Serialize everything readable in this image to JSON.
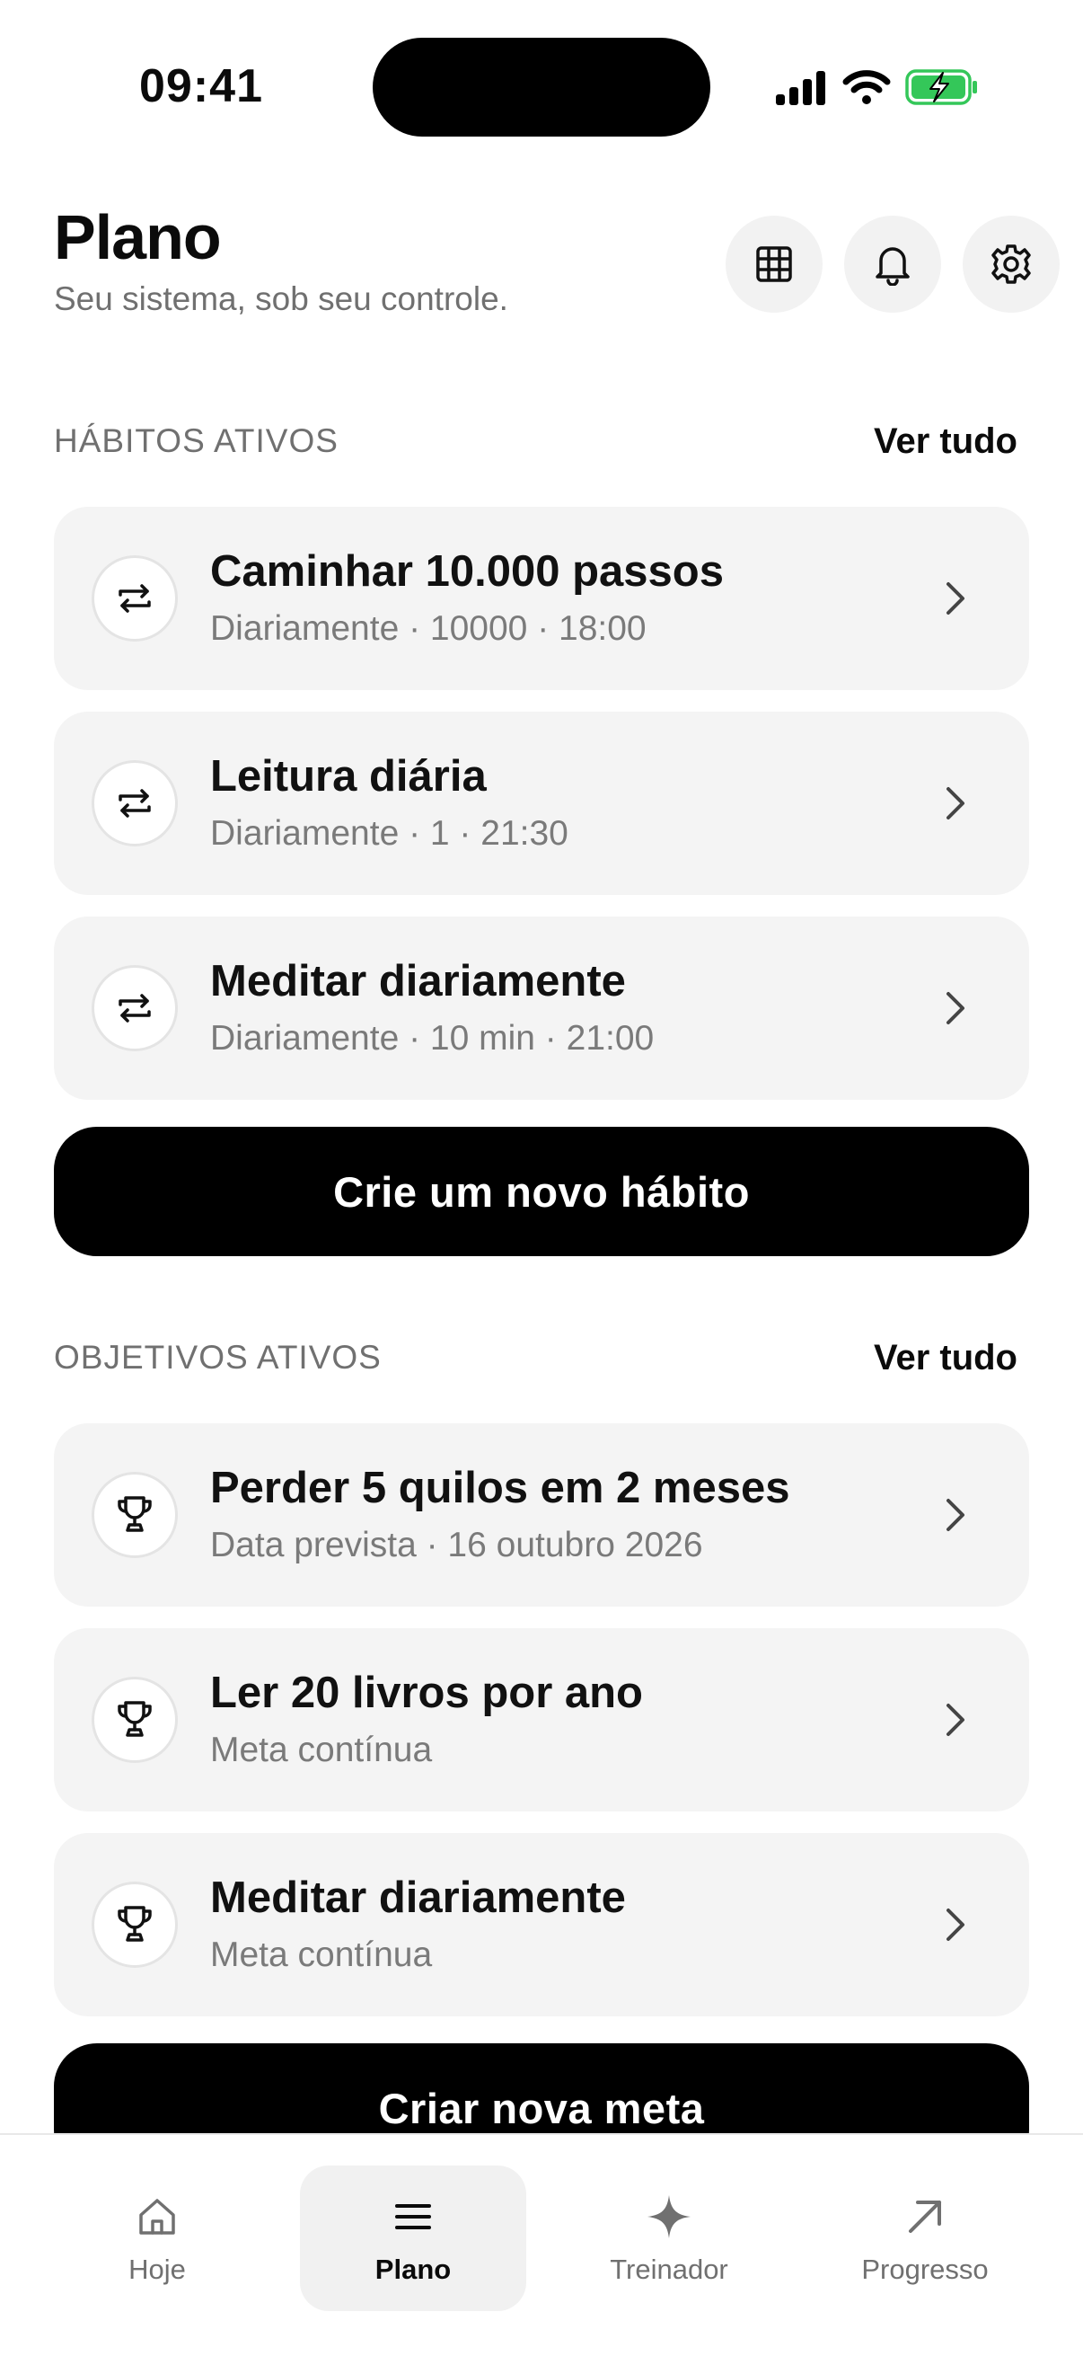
{
  "status_bar": {
    "time": "09:41"
  },
  "header": {
    "title": "Plano",
    "subtitle": "Seu sistema, sob seu controle.",
    "buttons": [
      "grid-icon",
      "bell-icon",
      "gear-icon"
    ]
  },
  "habits": {
    "label": "HÁBITOS ATIVOS",
    "see_all": "Ver tudo",
    "items": [
      {
        "title": "Caminhar 10.000 passos",
        "subtitle": "Diariamente · 10000 · 18:00",
        "icon": "repeat-icon"
      },
      {
        "title": "Leitura diária",
        "subtitle": "Diariamente · 1 · 21:30",
        "icon": "repeat-icon"
      },
      {
        "title": "Meditar diariamente",
        "subtitle": "Diariamente · 10 min · 21:00",
        "icon": "repeat-icon"
      }
    ],
    "create_button": "Crie um novo hábito"
  },
  "goals": {
    "label": "OBJETIVOS ATIVOS",
    "see_all": "Ver tudo",
    "items": [
      {
        "title": "Perder 5 quilos em 2 meses",
        "subtitle": "Data prevista · 16 outubro 2026",
        "icon": "trophy-icon"
      },
      {
        "title": "Ler 20 livros por ano",
        "subtitle": "Meta contínua",
        "icon": "trophy-icon"
      },
      {
        "title": "Meditar diariamente",
        "subtitle": "Meta contínua",
        "icon": "trophy-icon"
      }
    ],
    "create_button": "Criar nova meta"
  },
  "tabbar": {
    "active": "Plano",
    "tabs": [
      {
        "label": "Hoje",
        "icon": "home-icon"
      },
      {
        "label": "Plano",
        "icon": "menu-icon"
      },
      {
        "label": "Treinador",
        "icon": "sparkle-icon"
      },
      {
        "label": "Progresso",
        "icon": "arrow-up-right-icon"
      }
    ]
  },
  "colors": {
    "accent": "#000000",
    "card": "#f4f4f4",
    "muted_text": "#707070",
    "battery_green": "#34c759"
  }
}
